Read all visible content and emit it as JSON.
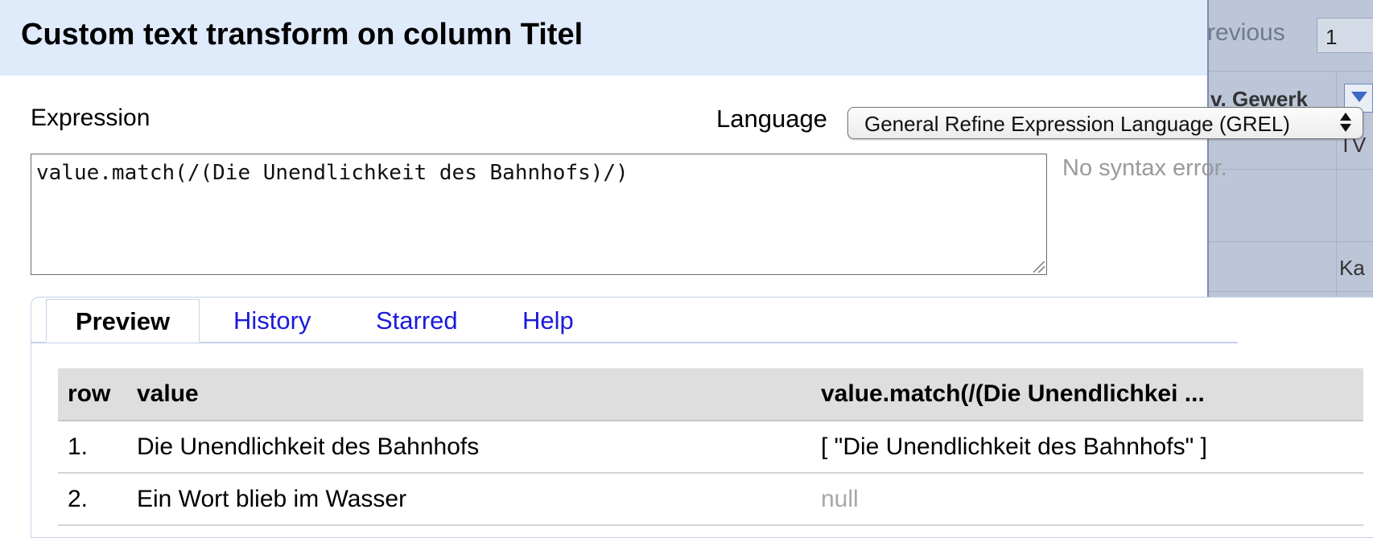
{
  "background": {
    "pager_prev_label": "revious",
    "pager_page_value": "1",
    "column_header_label": "v. Gewerk",
    "cells": [
      "TV",
      "Ka"
    ]
  },
  "dialog": {
    "title": "Custom text transform on column Titel",
    "expression_label": "Expression",
    "language_label": "Language",
    "language_selected": "General Refine Expression Language (GREL)",
    "expression_value": "value.match(/(Die Unendlichkeit des Bahnhofs)/)",
    "syntax_status": "No syntax error."
  },
  "tabs": [
    {
      "label": "Preview",
      "active": true
    },
    {
      "label": "History",
      "active": false
    },
    {
      "label": "Starred",
      "active": false
    },
    {
      "label": "Help",
      "active": false
    }
  ],
  "preview": {
    "headers": [
      "row",
      "value",
      "value.match(/(Die Unendlichkei ..."
    ],
    "rows": [
      {
        "row": "1.",
        "value": "Die Unendlichkeit des Bahnhofs",
        "result": "[ \"Die Unendlichkeit des Bahnhofs\" ]",
        "is_null": false
      },
      {
        "row": "2.",
        "value": "Ein Wort blieb im Wasser",
        "result": "null",
        "is_null": true
      }
    ]
  },
  "colors": {
    "header_bg": "#dfeafb",
    "tab_link": "#1a1adc",
    "table_header_bg": "#dedede",
    "muted_text": "#9a9a9a"
  }
}
